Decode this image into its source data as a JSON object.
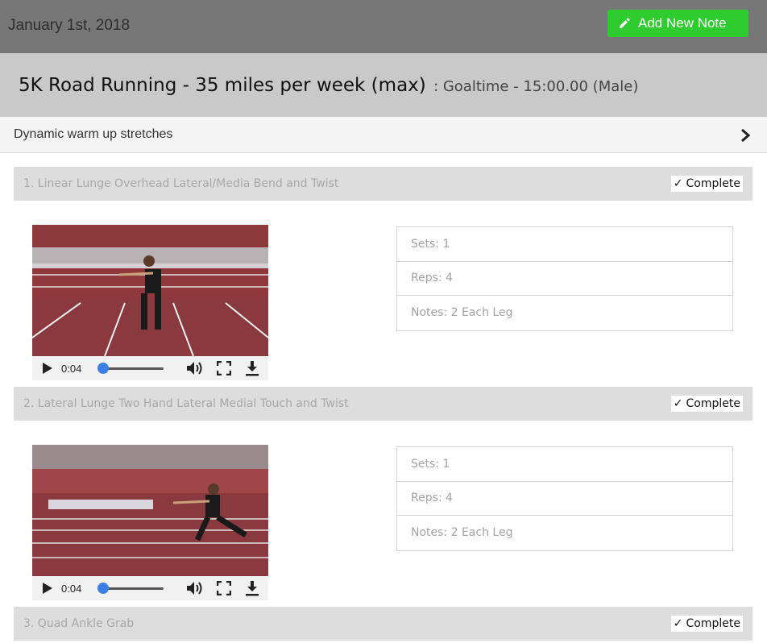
{
  "header": {
    "date": "January 1st, 2018",
    "add_note_label": "Add New Note"
  },
  "plan": {
    "title": "5K Road Running - 35 miles per week (max)",
    "goal": ": Goaltime - 15:00.00 (Male)"
  },
  "section": {
    "label": "Dynamic warm up stretches"
  },
  "exercises": [
    {
      "title": "1. Linear Lunge Overhead Lateral/Media Bend and Twist",
      "complete_label": "Complete",
      "video": {
        "time": "0:04",
        "progress": 0.05
      },
      "sets": "Sets: 1",
      "reps": "Reps: 4",
      "notes": "Notes: 2 Each Leg"
    },
    {
      "title": "2. Lateral Lunge Two Hand Lateral Medial Touch and Twist",
      "complete_label": "Complete",
      "video": {
        "time": "0:04",
        "progress": 0.05
      },
      "sets": "Sets: 1",
      "reps": "Reps: 4",
      "notes": "Notes: 2 Each Leg"
    },
    {
      "title": "3. Quad Ankle Grab",
      "complete_label": "Complete"
    }
  ],
  "colors": {
    "topbar": "#777777",
    "add_button": "#2ecc2e",
    "plan_bar": "#c9c9c9",
    "track": "#8a3a3e"
  }
}
